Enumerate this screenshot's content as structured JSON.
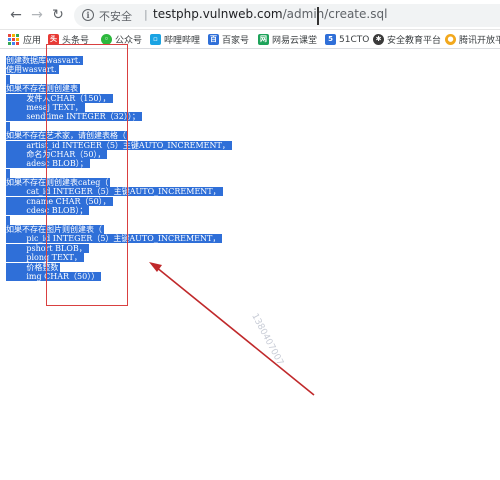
{
  "browser": {
    "insecure_label": "不安全",
    "separator": "|",
    "url_host": "testphp.vulnweb.com",
    "url_path": "/admin/create.sql"
  },
  "bookmarks": [
    {
      "label": "应用",
      "icon": "apps-grid-icon"
    },
    {
      "label": "头条号",
      "icon": "toutiao-icon",
      "color": "#e83a35"
    },
    {
      "label": "公众号",
      "icon": "wechat-icon",
      "color": "#2db83d"
    },
    {
      "label": "哔哩哔哩",
      "icon": "bilibili-icon",
      "color": "#1aa3e3"
    },
    {
      "label": "百家号",
      "icon": "baijiahao-icon",
      "color": "#2f6fd8"
    },
    {
      "label": "网易云课堂",
      "icon": "netease-study-icon",
      "color": "#1ea35a"
    },
    {
      "label": "51CTO",
      "icon": "51cto-icon",
      "color": "#2f6fd8"
    },
    {
      "label": "安全教育平台",
      "icon": "safety-edu-icon",
      "color": "#3a3a3a"
    },
    {
      "label": "腾讯开放平",
      "icon": "tencent-icon",
      "color": "#f2a81d"
    }
  ],
  "sql_lines": [
    "创建数据库wasvart.",
    "使用wasvart.",
    "",
    "如果不存在则创建表",
    "        发件人CHAR（150），",
    "        mesaj TEXT，",
    "        sendtime INTEGER（32））；",
    "",
    "如果不存在艺术家，请创建表格（",
    "        artist_id INTEGER（5）主键AUTO_INCREMENT，",
    "        命名为CHAR（50），",
    "        adesc BLOB）；",
    "",
    "如果不存在则创建表categ（",
    "        cat_id INTEGER（5）主键AUTO_INCREMENT，",
    "        cname CHAR（50），",
    "        cdesc BLOB）；",
    "",
    "如果不存在图片则创建表（",
    "        pic_id INTEGER（5）主键AUTO_INCREMENT，",
    "        pshort BLOB，",
    "        plong TEXT，",
    "        价格整数",
    "        img CHAR（50））"
  ],
  "watermark": "1380407007",
  "colors": {
    "selection": "#2f6fd8",
    "annotation_red": "#d94040",
    "arrow_red": "#c0292b"
  }
}
